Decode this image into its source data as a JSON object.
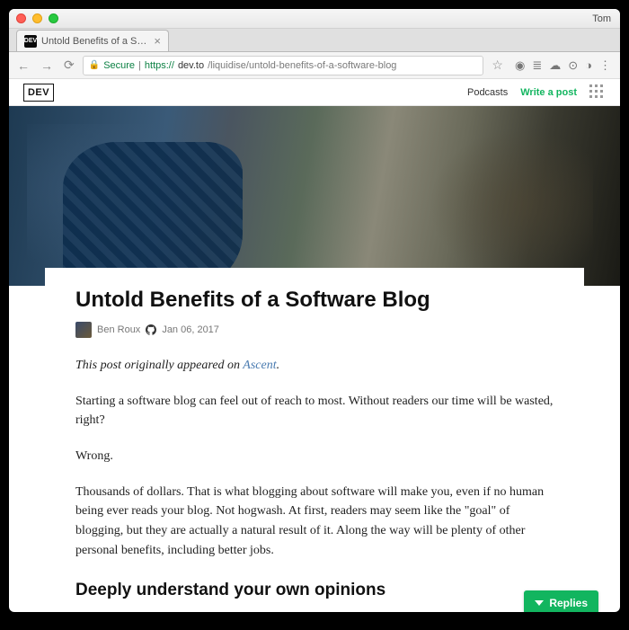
{
  "window": {
    "user": "Tom"
  },
  "tab": {
    "title": "Untold Benefits of a Software",
    "favicon_text": "DEV"
  },
  "addressbar": {
    "secure_label": "Secure",
    "url_prefix": "https://",
    "url_host": "dev.to",
    "url_path": "/liquidise/untold-benefits-of-a-software-blog"
  },
  "sitenav": {
    "logo": "DEV",
    "links": {
      "podcasts": "Podcasts",
      "write": "Write a post"
    }
  },
  "article": {
    "title": "Untold Benefits of a Software Blog",
    "author": "Ben Roux",
    "date": "Jan 06, 2017",
    "intro_prefix": "This post originally appeared on ",
    "intro_link": "Ascent",
    "intro_suffix": ".",
    "p1": "Starting a software blog can feel out of reach to most. Without readers our time will be wasted, right?",
    "p2": "Wrong.",
    "p3": "Thousands of dollars. That is what blogging about software will make you, even if no human being ever reads your blog. Not hogwash. At first, readers may seem like the \"goal\" of blogging, but they are actually a natural result of it. Along the way will be plenty of other personal benefits, including better jobs.",
    "h2_1": "Deeply understand your own opinions"
  },
  "replies_button": "Replies"
}
